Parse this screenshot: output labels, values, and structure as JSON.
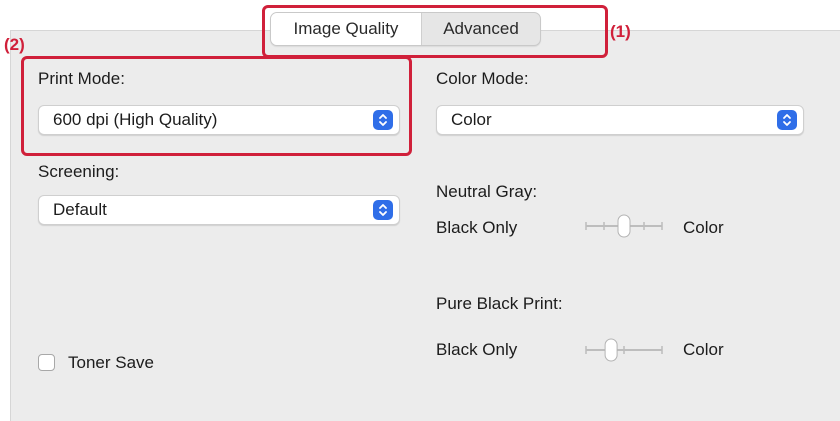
{
  "tabs": [
    {
      "label": "Image Quality",
      "active": true
    },
    {
      "label": "Advanced",
      "active": false
    }
  ],
  "annotations": {
    "tabs_marker": "(1)",
    "print_mode_marker": "(2)",
    "highlight_color": "#d0203a"
  },
  "left": {
    "print_mode": {
      "label": "Print Mode:",
      "value": "600 dpi (High Quality)"
    },
    "screening": {
      "label": "Screening:",
      "value": "Default"
    },
    "toner_save": {
      "label": "Toner Save",
      "checked": false
    }
  },
  "right": {
    "color_mode": {
      "label": "Color Mode:",
      "value": "Color"
    },
    "neutral_gray": {
      "label": "Neutral Gray:",
      "min_label": "Black Only",
      "max_label": "Color",
      "level": 0.5
    },
    "pure_black_print": {
      "label": "Pure Black Print:",
      "min_label": "Black Only",
      "max_label": "Color",
      "level": 0.33
    }
  },
  "colors": {
    "accent": "#2f6ee8",
    "panel_bg": "#ececec"
  }
}
